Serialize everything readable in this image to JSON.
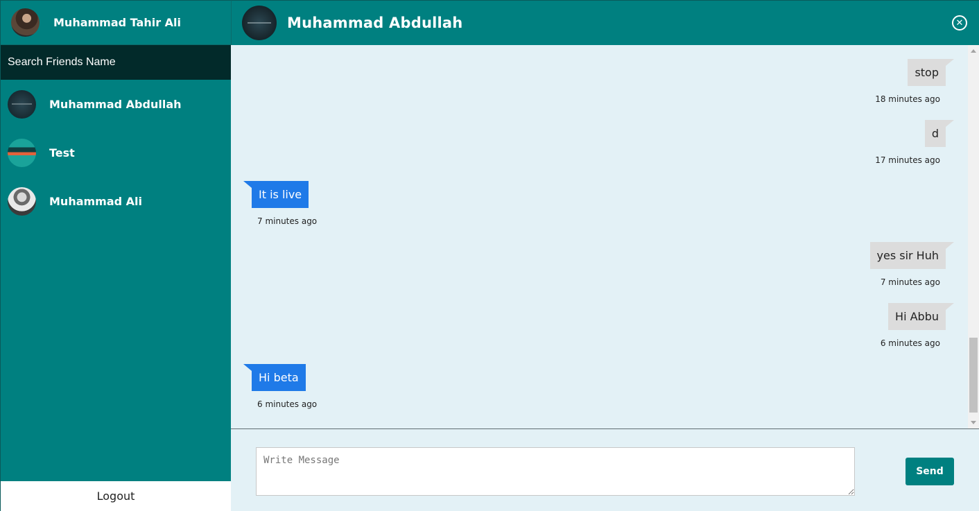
{
  "sidebar": {
    "current_user": "Muhammad Tahir Ali",
    "search_placeholder": "Search Friends Name",
    "friends": [
      {
        "name": "Muhammad Abdullah"
      },
      {
        "name": "Test"
      },
      {
        "name": "Muhammad Ali"
      }
    ],
    "logout_label": "Logout"
  },
  "chat": {
    "title": "Muhammad Abdullah",
    "close_icon": "close-circle-icon",
    "messages": [
      {
        "direction": "out",
        "text": "stop",
        "time": "18 minutes ago"
      },
      {
        "direction": "out",
        "text": "d",
        "time": "17 minutes ago"
      },
      {
        "direction": "in",
        "text": "It is live",
        "time": "7 minutes ago"
      },
      {
        "direction": "out",
        "text": "yes sir Huh",
        "time": "7 minutes ago"
      },
      {
        "direction": "out",
        "text": "Hi Abbu",
        "time": "6 minutes ago"
      },
      {
        "direction": "in",
        "text": "Hi beta",
        "time": "6 minutes ago"
      }
    ]
  },
  "composer": {
    "placeholder": "Write Message",
    "send_label": "Send"
  },
  "colors": {
    "teal": "#008080",
    "dark_search": "#022a2a",
    "chat_bg": "#e3f1f6",
    "incoming_bubble": "#1f7ae8",
    "outgoing_bubble": "#dcdcdc"
  }
}
